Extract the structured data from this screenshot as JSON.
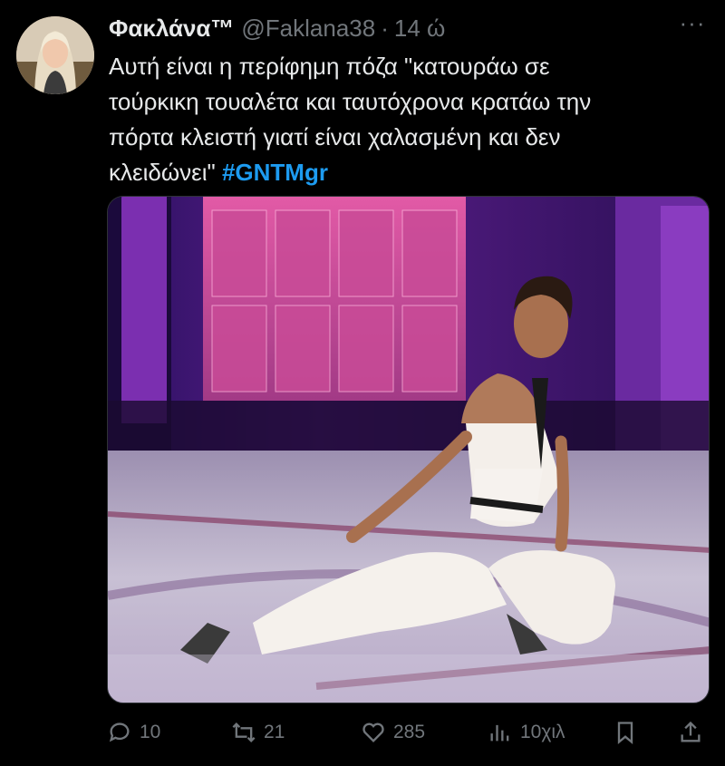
{
  "tweet": {
    "display_name": "Φακλάνα™",
    "handle": "@Faklana38",
    "separator": "·",
    "time": "14 ώ",
    "more_label": "···",
    "text_lines": [
      "Αυτή είναι η περίφημη πόζα \"κατουράω σε",
      "τούρκικη τουαλέτα και ταυτόχρονα κρατάω την",
      "πόρτα κλειστή γιατί είναι χαλασμένη και δεν"
    ],
    "text_last_line": "κλειδώνει\" ",
    "hashtag": "#GNTMgr"
  },
  "actions": {
    "replies": "10",
    "reposts": "21",
    "likes": "285",
    "views": "10χιλ"
  },
  "icons": {
    "reply": "reply-icon",
    "repost": "repost-icon",
    "like": "heart-icon",
    "views": "views-icon",
    "bookmark": "bookmark-icon",
    "share": "share-icon",
    "more": "more-icon"
  },
  "colors": {
    "background": "#000000",
    "text": "#e7e9ea",
    "muted": "#71767b",
    "link": "#1d9bf0"
  }
}
